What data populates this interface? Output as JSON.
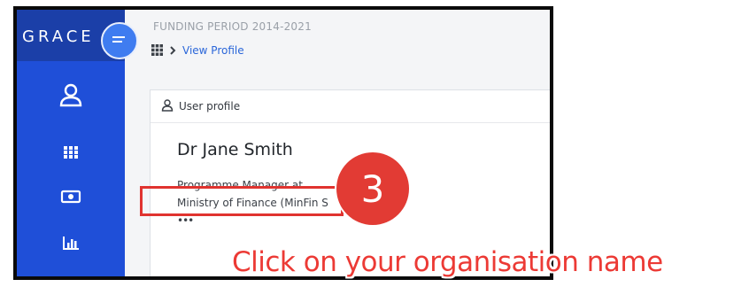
{
  "app": {
    "brand": "GRACE",
    "funding_period": "FUNDING PERIOD 2014-2021"
  },
  "breadcrumb": {
    "current": "View Profile"
  },
  "sidebar": {
    "items": [
      {
        "icon": "user-icon"
      },
      {
        "icon": "grid-icon"
      },
      {
        "icon": "money-icon"
      },
      {
        "icon": "chart-icon"
      }
    ]
  },
  "profile_card": {
    "header_label": "User profile",
    "name": "Dr Jane Smith",
    "role": "Programme Manager at",
    "organisation": "Ministry of Finance (MinFin S",
    "more": "•••"
  },
  "annotation": {
    "step": "3",
    "instruction": "Click on your organisation name",
    "highlight_color": "#e0332f"
  },
  "colors": {
    "sidebar": "#1f4fd8",
    "brand_bar": "#1b3fa8",
    "link": "#2a66d9",
    "accent_red": "#e23b34"
  }
}
